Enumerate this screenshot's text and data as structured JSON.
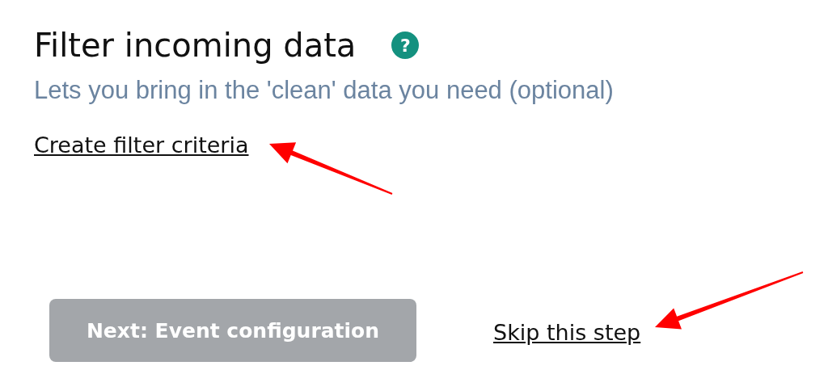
{
  "heading": {
    "title": "Filter incoming data",
    "help": "?"
  },
  "subtitle": "Lets you bring in the 'clean' data you need (optional)",
  "create_link": "Create filter criteria",
  "next_button": {
    "label": "Next: Event configuration",
    "disabled": true
  },
  "skip_link": "Skip this step"
}
